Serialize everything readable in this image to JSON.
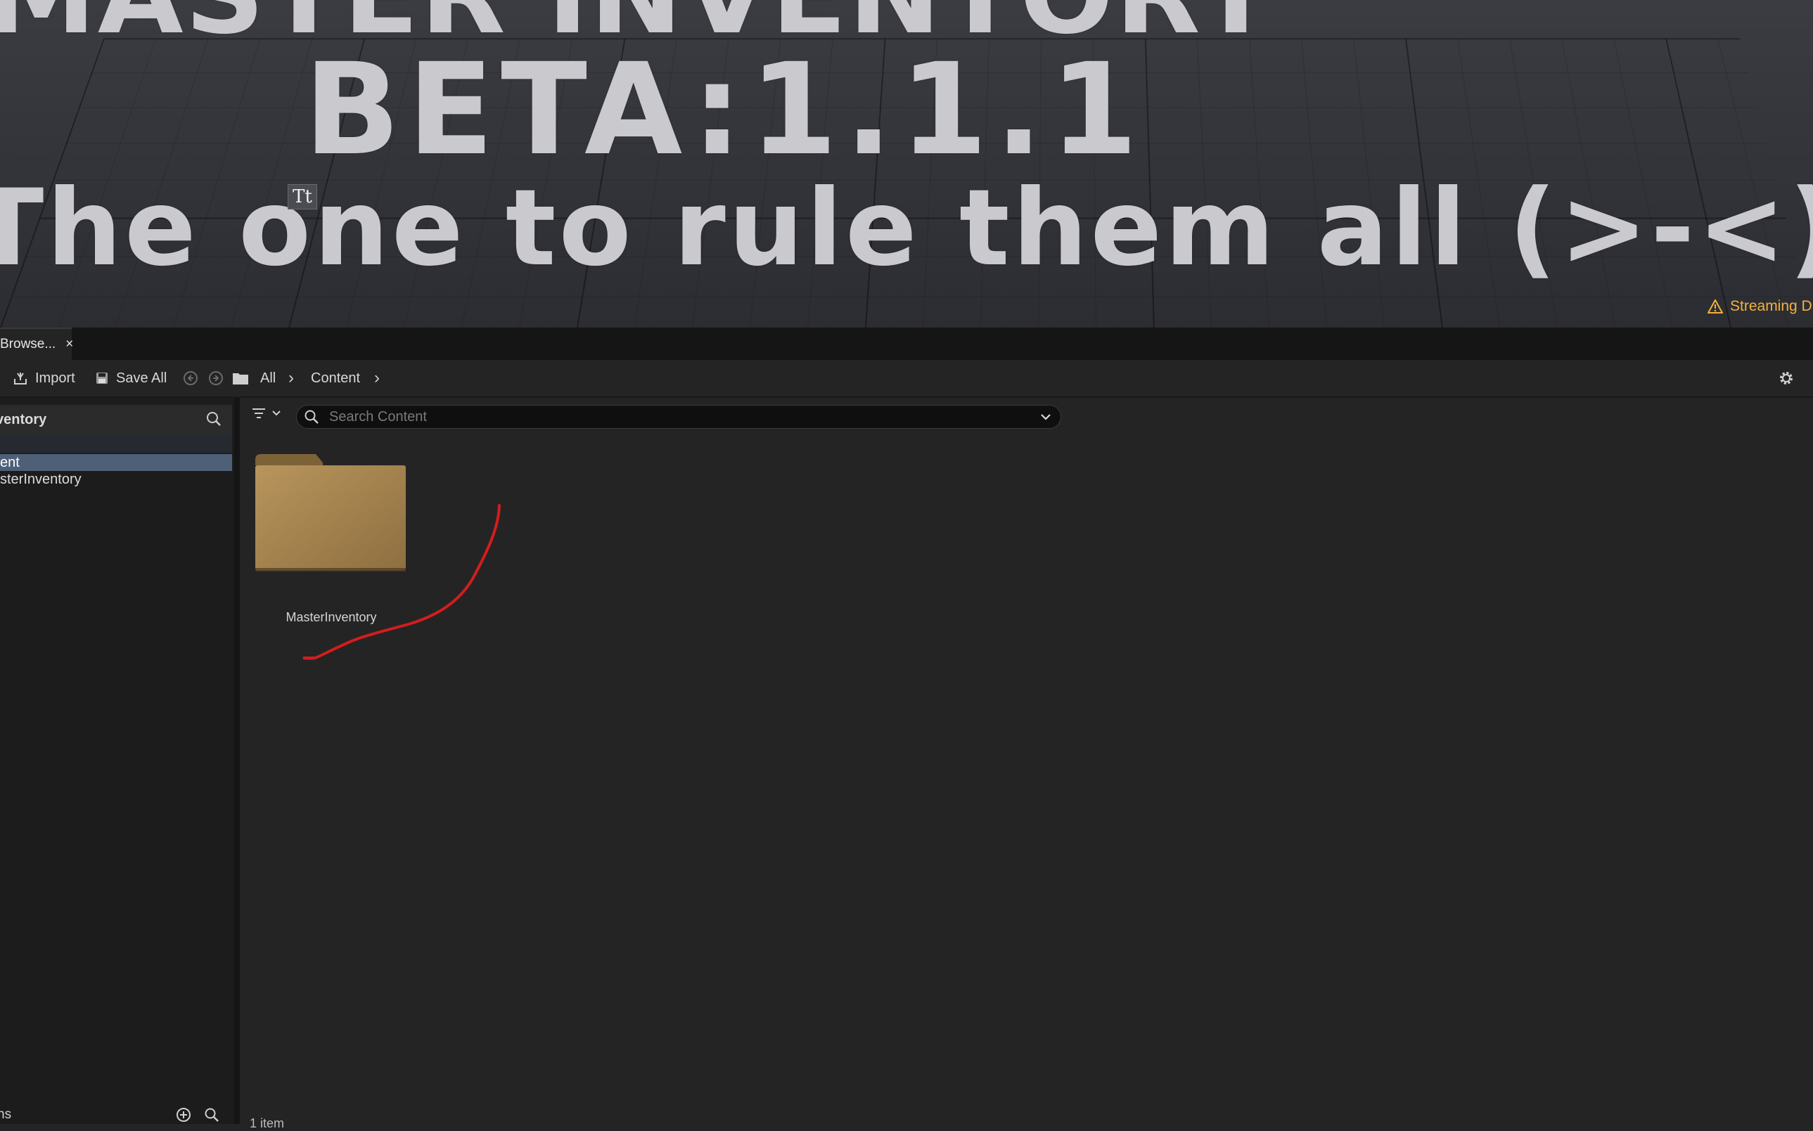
{
  "viewport": {
    "title_line": "MASTER INVENTORY",
    "beta_line": "BETA:1.1.1",
    "tagline": "The one to rule them all (>-<)",
    "text_marker": "Tt",
    "streaming_warning": "Streaming D"
  },
  "tab": {
    "label": "Browse...",
    "close": "×"
  },
  "toolbar": {
    "import_label": "Import",
    "save_all_label": "Save All",
    "breadcrumb": [
      "All",
      "Content"
    ]
  },
  "sidebar": {
    "title": "ventory",
    "tree": [
      {
        "label": "ent",
        "selected": true
      },
      {
        "label": "sterInventory",
        "selected": false
      }
    ],
    "footer_label": "ns"
  },
  "search": {
    "placeholder": "Search Content",
    "value": ""
  },
  "content": {
    "items": [
      {
        "name": "MasterInventory",
        "type": "folder"
      }
    ],
    "item_count": "1 item"
  },
  "colors": {
    "folder": "#a68651",
    "selection": "#4d6078",
    "warning": "#f3b23b",
    "annotation": "#d21d1d"
  }
}
